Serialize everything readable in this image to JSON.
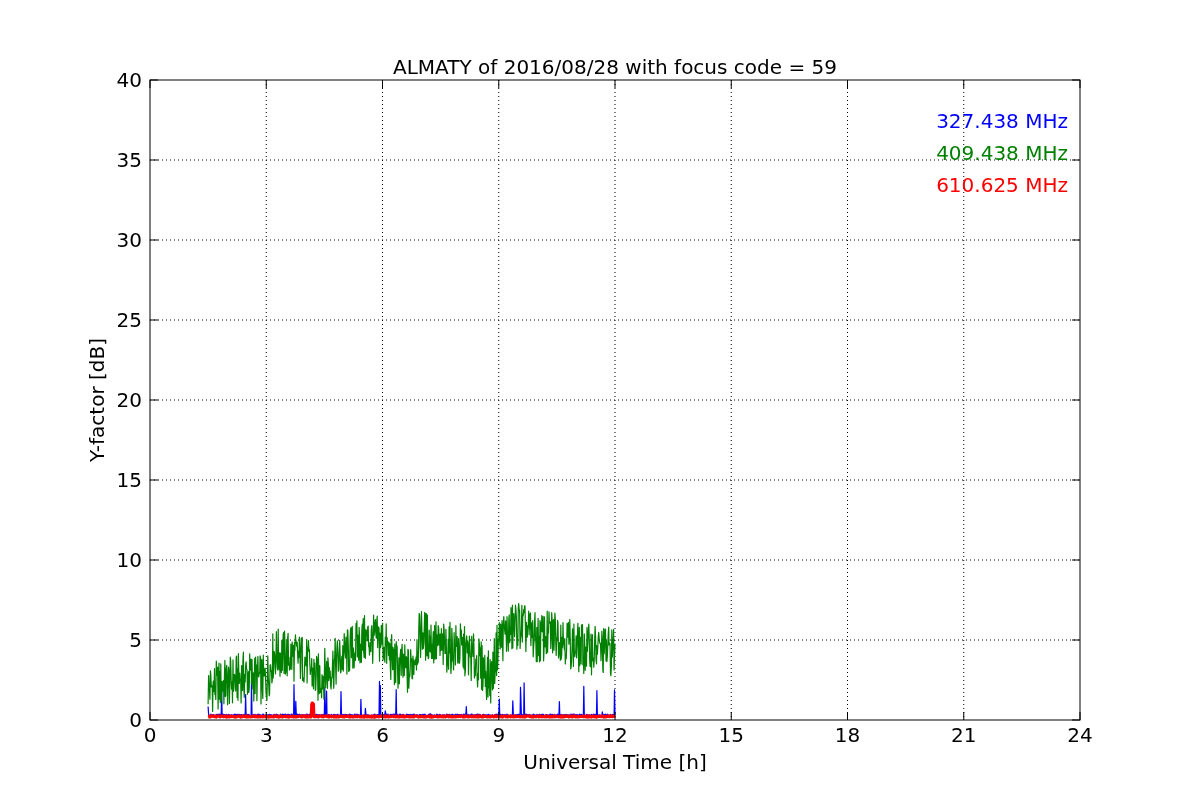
{
  "plot": {
    "title": "ALMATY of 2016/08/28 with focus code = 59",
    "xlabel": "Universal Time [h]",
    "ylabel": "Y-factor [dB]",
    "xticks": [
      "0",
      "3",
      "6",
      "9",
      "12",
      "15",
      "18",
      "21",
      "24"
    ],
    "yticks": [
      "40",
      "35",
      "30",
      "25",
      "20",
      "15",
      "10",
      "5",
      "0"
    ],
    "series": [
      {
        "label": "327.438 MHz",
        "color": "#0000ff",
        "kind": "spiky"
      },
      {
        "label": "409.438 MHz",
        "color": "#008000",
        "kind": "wide"
      },
      {
        "label": "610.625 MHz",
        "color": "#ff0000",
        "kind": "flat"
      }
    ]
  }
}
